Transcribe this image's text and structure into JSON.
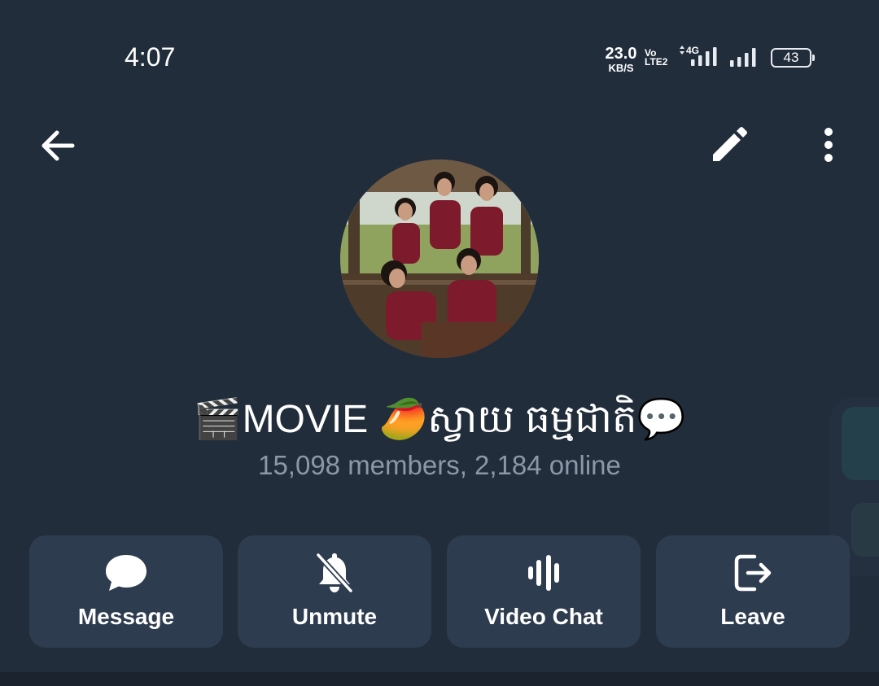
{
  "status_bar": {
    "time": "4:07",
    "net_speed_value": "23.0",
    "net_speed_unit": "KB/S",
    "volte_top": "Vo",
    "volte_bottom": "LTE2",
    "network_type": "4G",
    "battery": "43"
  },
  "toolbar": {
    "back_icon": "arrow-left-icon",
    "edit_icon": "pencil-icon",
    "more_icon": "more-vertical-icon"
  },
  "profile": {
    "avatar_icon": "group-photo-avatar",
    "title": "🎬MOVIE 🥭ស្វាយ ធម្មជាតិ💬",
    "subtitle": "15,098 members, 2,184 online"
  },
  "actions": [
    {
      "label": "Message",
      "icon": "chat-bubble-icon"
    },
    {
      "label": "Unmute",
      "icon": "bell-off-icon"
    },
    {
      "label": "Video Chat",
      "icon": "voice-chat-icon"
    },
    {
      "label": "Leave",
      "icon": "logout-icon"
    }
  ],
  "colors": {
    "background": "#222d3b",
    "button_bg": "#2e3c50",
    "subtitle": "#8b98a7",
    "text": "#ffffff"
  }
}
